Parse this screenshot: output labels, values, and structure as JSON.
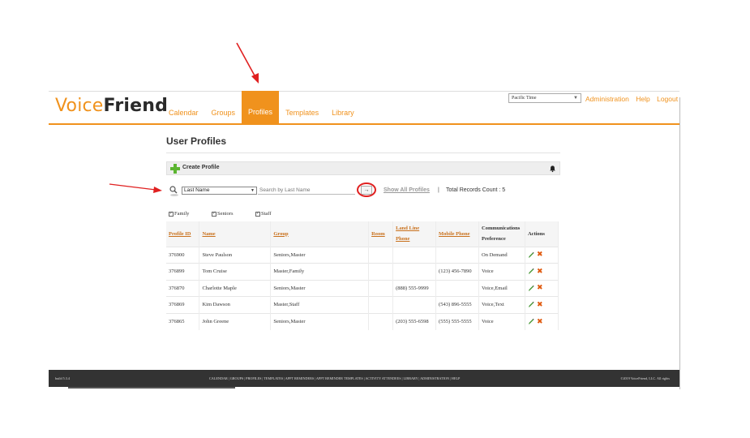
{
  "header": {
    "logo": {
      "voice": "Voice",
      "friend": "Friend"
    },
    "nav": [
      {
        "label": "Calendar",
        "active": false
      },
      {
        "label": "Groups",
        "active": false
      },
      {
        "label": "Profiles",
        "active": true
      },
      {
        "label": "Templates",
        "active": false
      },
      {
        "label": "Library",
        "active": false
      }
    ],
    "timezone": {
      "selected": "Pacific Time"
    },
    "links": [
      "Administration",
      "Help",
      "Logout"
    ]
  },
  "main": {
    "title": "User Profiles",
    "create_label": "Create Profile",
    "search": {
      "field_selected": "Last Name",
      "placeholder": "Search by Last Name",
      "go_glyph": "→",
      "show_all": "Show All Profiles",
      "separator": "|",
      "total_label": "Total Records Count :",
      "total_value": "5"
    },
    "filters": [
      {
        "label": "Family",
        "checked": true
      },
      {
        "label": "Seniors",
        "checked": true
      },
      {
        "label": "Staff",
        "checked": true
      }
    ],
    "table": {
      "headers": {
        "profile_id": "Profile ID",
        "name": "Name",
        "group": "Group",
        "room": "Room",
        "land_line_1": "Land Line",
        "land_line_2": "Phone",
        "mobile": "Mobile Phone",
        "comm_1": "Communications",
        "comm_2": "Preference",
        "actions": "Actions"
      },
      "rows": [
        {
          "id": "376900",
          "name": "Steve Paulson",
          "group": "Seniors,Master",
          "room": "",
          "land": "",
          "mobile": "",
          "pref": "On Demand"
        },
        {
          "id": "376899",
          "name": "Tom Cruise",
          "group": "Master,Family",
          "room": "",
          "land": "",
          "mobile": "(123) 456-7890",
          "pref": "Voice"
        },
        {
          "id": "376870",
          "name": "Charlotte Maple",
          "group": "Seniors,Master",
          "room": "",
          "land": "(888) 555-9999",
          "mobile": "",
          "pref": "Voice,Email"
        },
        {
          "id": "376869",
          "name": "Kim Dawson",
          "group": "Master,Staff",
          "room": "",
          "land": "",
          "mobile": "(543) 896-5555",
          "pref": "Voice,Text"
        },
        {
          "id": "376865",
          "name": "John Greene",
          "group": "Seniors,Master",
          "room": "",
          "land": "(203) 555-6598",
          "mobile": "(555) 555-5555",
          "pref": "Voice"
        }
      ]
    }
  },
  "footer": {
    "build": "build 5.3.4",
    "links": "CALENDAR | GROUPS | PROFILES | TEMPLATES | APPT REMINDERS | APPT REMINDER TEMPLATES | ACTIVITY ATTENDEES | LIBRARY | ADMINISTRATION | HELP",
    "copyright": "©2019 VoiceFriend, LLC. All rights"
  },
  "colors": {
    "brand_orange": "#f0921d",
    "header_text_orange": "#c9711d",
    "annotation_red": "#e02020",
    "footer_bg": "#333333",
    "add_green": "#5cb531"
  },
  "icons": [
    "search-icon",
    "plus-icon",
    "bell-icon",
    "arrow-right-icon",
    "edit-pencil-icon",
    "delete-x-icon",
    "dropdown-caret-icon",
    "checkbox-icon"
  ]
}
